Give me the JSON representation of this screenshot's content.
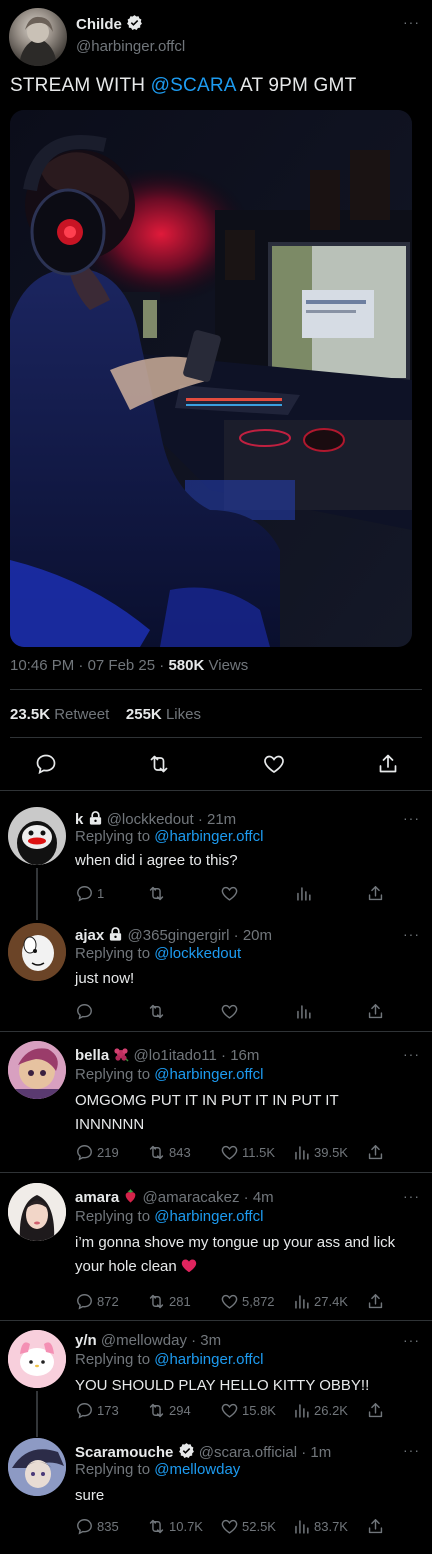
{
  "main_tweet": {
    "display_name": "Childe",
    "handle": "@harbinger.offcl",
    "text_before": "STREAM WITH ",
    "mention": "@SCARA",
    "text_after": " AT 9PM GMT",
    "time": "10:46 PM",
    "date": "07 Feb 25",
    "views_count": "580K",
    "views_label": "Views",
    "retweets_count": "23.5K",
    "retweets_label": "Retweet",
    "likes_count": "255K",
    "likes_label": "Likes",
    "more_label": "···"
  },
  "replies": [
    {
      "name": "k",
      "handle": "@lockkedout",
      "time": "21m",
      "reply_prefix": "Replying to",
      "reply_to": "@harbinger.offcl",
      "text": "when did i agree to this?",
      "replies": "1",
      "retweets": "",
      "likes": "",
      "views": ""
    },
    {
      "name": "ajax",
      "handle": "@365gingergirl",
      "time": "20m",
      "reply_prefix": "Replying to",
      "reply_to": "@lockkedout",
      "text": "just now!",
      "replies": "",
      "retweets": "",
      "likes": "",
      "views": ""
    },
    {
      "name": "bella",
      "handle": "@lo1itado11",
      "time": "16m",
      "reply_prefix": "Replying to",
      "reply_to": "@harbinger.offcl",
      "text": "OMGOMG PUT IT IN PUT IT IN PUT IT INNNNNN",
      "replies": "219",
      "retweets": "843",
      "likes": "11.5K",
      "views": "39.5K"
    },
    {
      "name": "amara",
      "handle": "@amaracakez",
      "time": "4m",
      "reply_prefix": "Replying to",
      "reply_to": "@harbinger.offcl",
      "text": "i’m gonna shove my tongue up your ass and lick your hole clean",
      "replies": "872",
      "retweets": "281",
      "likes": "5,872",
      "views": "27.4K"
    },
    {
      "name": "y/n",
      "handle": "@mellowday",
      "time": "3m",
      "reply_prefix": "Replying to",
      "reply_to": "@harbinger.offcl",
      "text": "YOU SHOULD PLAY HELLO KITTY OBBY!!",
      "replies": "173",
      "retweets": "294",
      "likes": "15.8K",
      "views": "26.2K"
    },
    {
      "name": "Scaramouche",
      "handle": "@scara.official",
      "time": "1m",
      "reply_prefix": "Replying to",
      "reply_to": "@mellowday",
      "text": "sure",
      "replies": "835",
      "retweets": "10.7K",
      "likes": "52.5K",
      "views": "83.7K"
    }
  ],
  "separator": "·",
  "colors": {
    "background": "#000000",
    "text": "#e7e9ea",
    "muted": "#71767b",
    "accent": "#1d9bf0",
    "divider": "#2f3336",
    "heart_emoji": "#e0245e"
  }
}
